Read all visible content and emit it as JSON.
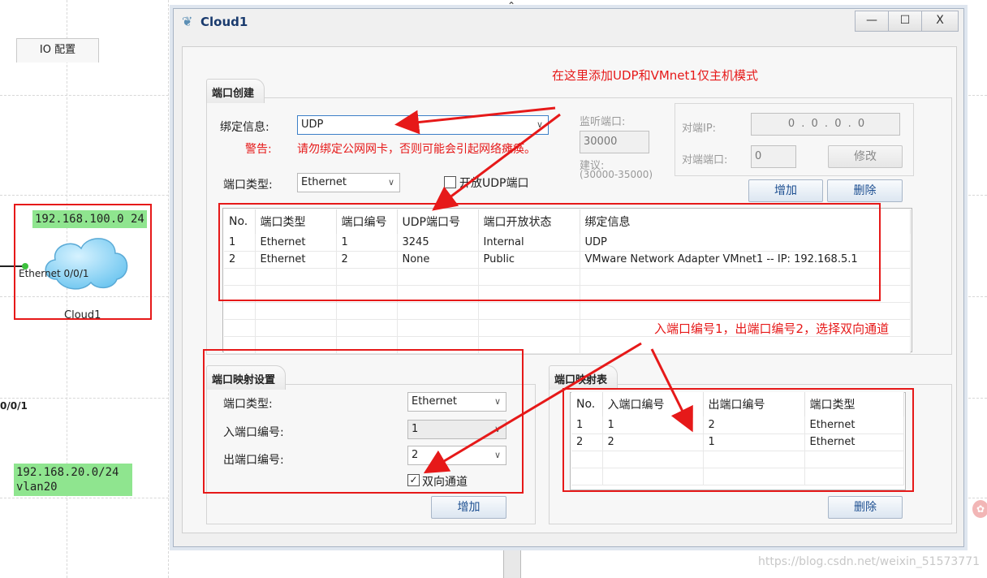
{
  "background": {
    "net_labels": [
      "192.168.100.0 24",
      "192.168.20.0/24",
      "vlan20"
    ],
    "port_label": "Ethernet 0/0/1",
    "device_label": "Cloud1",
    "partial_port": "0/0/1",
    "watermark": "https://blog.csdn.net/weixin_51573771"
  },
  "window": {
    "title": "Cloud1",
    "minimize": "—",
    "maximize": "☐",
    "close": "X",
    "tab": "IO 配置"
  },
  "port_create": {
    "title": "端口创建",
    "bind_label": "绑定信息:",
    "bind_value": "UDP",
    "warning_label": "警告:",
    "warning_text": "请勿绑定公网网卡，否则可能会引起网络瘫痪。",
    "port_type_label": "端口类型:",
    "port_type_value": "Ethernet",
    "open_udp_label": "开放UDP端口",
    "listen_port_label": "监听端口:",
    "listen_port_value": "30000",
    "suggest_label": "建议:",
    "suggest_range": "(30000-35000)",
    "peer_ip_label": "对端IP:",
    "peer_ip_value": "0 . 0 . 0 . 0",
    "peer_port_label": "对端端口:",
    "peer_port_value": "0",
    "modify_btn": "修改",
    "add_btn": "增加",
    "delete_btn": "删除",
    "table": {
      "headers": [
        "No.",
        "端口类型",
        "端口编号",
        "UDP端口号",
        "端口开放状态",
        "绑定信息"
      ],
      "rows": [
        [
          "1",
          "Ethernet",
          "1",
          "3245",
          "Internal",
          "UDP"
        ],
        [
          "2",
          "Ethernet",
          "2",
          "None",
          "Public",
          "VMware Network Adapter VMnet1 -- IP: 192.168.5.1"
        ]
      ]
    }
  },
  "port_map_settings": {
    "title": "端口映射设置",
    "port_type_label": "端口类型:",
    "port_type_value": "Ethernet",
    "in_port_label": "入端口编号:",
    "in_port_value": "1",
    "out_port_label": "出端口编号:",
    "out_port_value": "2",
    "bidirectional_label": "双向通道",
    "add_btn": "增加"
  },
  "port_map_table": {
    "title": "端口映射表",
    "headers": [
      "No.",
      "入端口编号",
      "出端口编号",
      "端口类型"
    ],
    "rows": [
      [
        "1",
        "1",
        "2",
        "Ethernet"
      ],
      [
        "2",
        "2",
        "1",
        "Ethernet"
      ]
    ],
    "delete_btn": "删除"
  },
  "annotations": {
    "top_note": "在这里添加UDP和VMnet1仅主机模式",
    "map_note": "入端口编号1，出端口编号2，选择双向通道"
  },
  "colors": {
    "annotation_red": "#e61919",
    "net_label_green": "#8fe58f",
    "cloud_blue": "#8fd3f5"
  }
}
